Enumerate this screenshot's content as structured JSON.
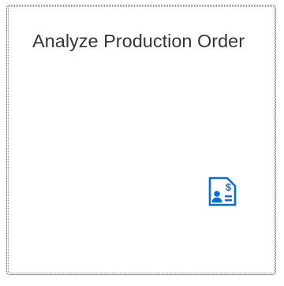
{
  "tile": {
    "title": "Analyze Production Order",
    "icon": "customer-financial-fact-sheet-icon",
    "icon_color": "#0a6ed1"
  }
}
